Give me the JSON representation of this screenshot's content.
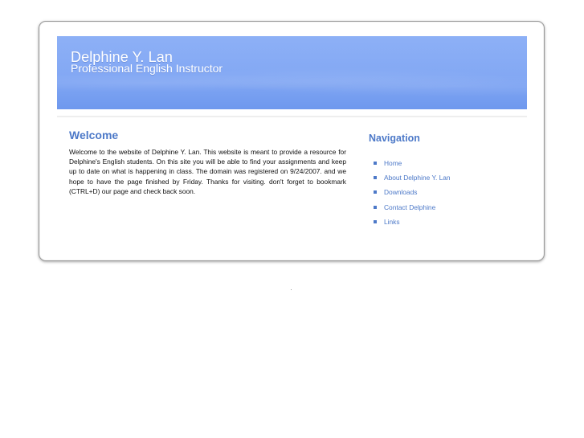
{
  "header": {
    "title": "Delphine Y. Lan",
    "subtitle": "Professional English Instructor"
  },
  "welcome": {
    "heading": "Welcome",
    "body": "Welcome to the website of Delphine Y. Lan. This website is meant to provide a resource for Delphine's English students. On this site you will be able to find your assignments and keep up to date on what is happening in class. The domain was registered on 9/24/2007. and we hope to have the page finished by Friday. Thanks for visiting. don't forget to bookmark (CTRL+D) our page and check back soon."
  },
  "navigation": {
    "heading": "Navigation",
    "items": [
      {
        "label": "Home"
      },
      {
        "label": "About Delphine Y. Lan"
      },
      {
        "label": "Downloads"
      },
      {
        "label": "Contact Delphine"
      },
      {
        "label": "Links"
      }
    ]
  },
  "colors": {
    "accent": "#4d79c8",
    "banner": "#83a8f4"
  }
}
